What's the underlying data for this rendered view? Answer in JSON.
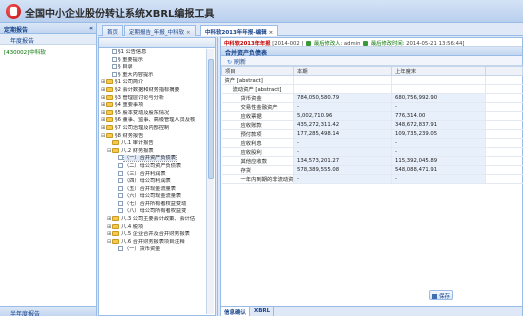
{
  "app": {
    "title": "全国中小企业股份转让系统XBRL编报工具"
  },
  "left_panel": {
    "header": "定期报告",
    "collapse_icon": "«",
    "subheader": "年度报告",
    "link": "[430002]中科软",
    "footer": "半年度报告"
  },
  "tabs": [
    {
      "label": "首页",
      "active": false,
      "closable": false
    },
    {
      "label": "定期报告_年报_中科软",
      "active": false,
      "closable": true
    },
    {
      "label": "中科软2013年年报-编辑",
      "active": true,
      "closable": true
    }
  ],
  "tree": {
    "items": [
      {
        "label": "§1 公告信息",
        "toggle": "",
        "level": 1,
        "kind": "check"
      },
      {
        "label": "§ 重要提示",
        "toggle": "",
        "level": 1,
        "kind": "check"
      },
      {
        "label": "§ 目录",
        "toggle": "",
        "level": 1,
        "kind": "check"
      },
      {
        "label": "§ 重大内容提示",
        "toggle": "",
        "level": 1,
        "kind": "check"
      },
      {
        "label": "§1 公司简介",
        "toggle": "+",
        "level": 0,
        "kind": "folder"
      },
      {
        "label": "§2 会计数据和财务指标摘要",
        "toggle": "+",
        "level": 0,
        "kind": "folder"
      },
      {
        "label": "§3 管理层讨论与分析",
        "toggle": "+",
        "level": 0,
        "kind": "folder"
      },
      {
        "label": "§4 重要事项",
        "toggle": "+",
        "level": 0,
        "kind": "folder"
      },
      {
        "label": "§5 股本变动及股东情况",
        "toggle": "+",
        "level": 0,
        "kind": "folder"
      },
      {
        "label": "§6 董事、监事、高级管理人员及核",
        "toggle": "+",
        "level": 0,
        "kind": "folder"
      },
      {
        "label": "§7 公司治理及内部控制",
        "toggle": "+",
        "level": 0,
        "kind": "folder"
      },
      {
        "label": "§8 财务报告",
        "toggle": "-",
        "level": 0,
        "kind": "folder"
      },
      {
        "label": "八.1 审计报告",
        "toggle": "",
        "level": 1,
        "kind": "folder"
      },
      {
        "label": "八.2 财务报表",
        "toggle": "-",
        "level": 1,
        "kind": "folder"
      },
      {
        "label": "（一）合并资产负债表",
        "toggle": "",
        "level": 2,
        "kind": "check",
        "selected": true
      },
      {
        "label": "（二）母公司资产负债表",
        "toggle": "",
        "level": 2,
        "kind": "check"
      },
      {
        "label": "（三）合并利润表",
        "toggle": "",
        "level": 2,
        "kind": "check"
      },
      {
        "label": "（四）母公司利润表",
        "toggle": "",
        "level": 2,
        "kind": "check"
      },
      {
        "label": "（五）合并现金流量表",
        "toggle": "",
        "level": 2,
        "kind": "check"
      },
      {
        "label": "（六）母公司现金流量表",
        "toggle": "",
        "level": 2,
        "kind": "check"
      },
      {
        "label": "（七）合并所有者权益变动",
        "toggle": "",
        "level": 2,
        "kind": "check"
      },
      {
        "label": "（八）母公司所有者权益变",
        "toggle": "",
        "level": 2,
        "kind": "check"
      },
      {
        "label": "八.3 公司主要会计政策、会计估",
        "toggle": "+",
        "level": 1,
        "kind": "folder"
      },
      {
        "label": "八.4 税项",
        "toggle": "+",
        "level": 1,
        "kind": "folder"
      },
      {
        "label": "八.5 企业合并及合并财务报表",
        "toggle": "+",
        "level": 1,
        "kind": "folder"
      },
      {
        "label": "八.6 合并财务报表项目注释",
        "toggle": "-",
        "level": 1,
        "kind": "folder"
      },
      {
        "label": "（一）货币资金",
        "toggle": "",
        "level": 2,
        "kind": "check"
      }
    ]
  },
  "report": {
    "status": {
      "title": "中科软2013年年报",
      "period": "[2014-002 (",
      "entry_label": "最后修改人:",
      "user": "admin",
      "time_label": "最后修改时间:",
      "time": "2014-05-21 13:56:44]"
    },
    "sheet_title": "合并资产负债表",
    "refresh_label": "刷新",
    "columns": [
      "项目",
      "本期",
      "上年度末",
      ""
    ],
    "rows": [
      {
        "item": "资产 [abstract]",
        "indent": 0,
        "current": null,
        "prior": null
      },
      {
        "item": "流动资产 [abstract]",
        "indent": 1,
        "current": null,
        "prior": null
      },
      {
        "item": "货币资金",
        "indent": 2,
        "current": "784,050,580.79",
        "prior": "680,756,992.90"
      },
      {
        "item": "交易性金融资产",
        "indent": 2,
        "current": "-",
        "prior": "-"
      },
      {
        "item": "应收票据",
        "indent": 2,
        "current": "5,002,710.96",
        "prior": "776,314.00"
      },
      {
        "item": "应收账款",
        "indent": 2,
        "current": "435,272,311.42",
        "prior": "348,672,837.91"
      },
      {
        "item": "预付款项",
        "indent": 2,
        "current": "177,285,498.14",
        "prior": "109,735,239.05"
      },
      {
        "item": "应收利息",
        "indent": 2,
        "current": "-",
        "prior": "-"
      },
      {
        "item": "应收股利",
        "indent": 2,
        "current": "-",
        "prior": "-"
      },
      {
        "item": "其他应收款",
        "indent": 2,
        "current": "134,573,201.27",
        "prior": "115,392,045.89"
      },
      {
        "item": "存货",
        "indent": 2,
        "current": "578,389,555.08",
        "prior": "548,088,471.91"
      },
      {
        "item": "一年内到期的非流动资产",
        "indent": 2,
        "current": "-",
        "prior": "-"
      }
    ],
    "save_label": "保存",
    "bottom_tabs": [
      "信息确认",
      "XBRL"
    ]
  },
  "colors": {
    "accent": "#15428b",
    "border": "#99bbe8",
    "title_red": "#c00000",
    "user_green": "#007000"
  }
}
